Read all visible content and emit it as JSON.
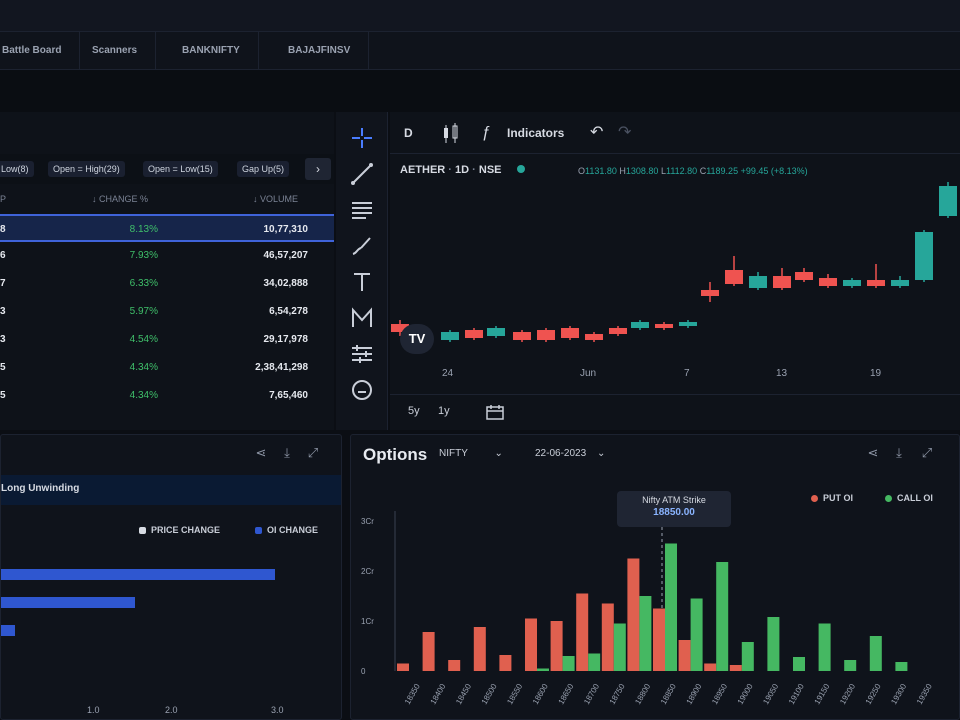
{
  "nav": {
    "tabs": [
      "Battle Board",
      "Scanners",
      "BANKNIFTY",
      "BAJAJFINSV"
    ]
  },
  "screener": {
    "filters": [
      "Low(8)",
      "Open = High(29)",
      "Open = Low(15)",
      "Gap Up(5)"
    ],
    "next_symbol": "›",
    "columns": [
      "P",
      "↓ CHANGE %",
      "↓ VOLUME"
    ],
    "rows": [
      {
        "sym": "8",
        "change": "8.13%",
        "volume": "10,77,310"
      },
      {
        "sym": "6",
        "change": "7.93%",
        "volume": "46,57,207"
      },
      {
        "sym": "7",
        "change": "6.33%",
        "volume": "34,02,888"
      },
      {
        "sym": "3",
        "change": "5.97%",
        "volume": "6,54,278"
      },
      {
        "sym": "3",
        "change": "4.54%",
        "volume": "29,17,978"
      },
      {
        "sym": "5",
        "change": "4.34%",
        "volume": "2,38,41,298"
      },
      {
        "sym": "5",
        "change": "4.34%",
        "volume": "7,65,460"
      }
    ]
  },
  "chart": {
    "interval": "D",
    "indicators_label": "Indicators",
    "symbol": "AETHER",
    "timeframe": "1D",
    "exchange": "NSE",
    "ohlc": {
      "o": "1131.80",
      "h": "1308.80",
      "l": "1112.80",
      "c": "1189.25",
      "change": "+99.45 (+8.13%)"
    },
    "x_ticks": [
      "24",
      "Jun",
      "7",
      "13",
      "19"
    ],
    "ranges": [
      "5y",
      "1y"
    ],
    "logo": "TV",
    "colors": {
      "up": "#26a69a",
      "down": "#ef5350"
    }
  },
  "oi_panel": {
    "tab_label": "Long Unwinding",
    "legend": [
      "PRICE CHANGE",
      "OI CHANGE"
    ],
    "x_ticks": [
      "1.0",
      "2.0",
      "3.0"
    ]
  },
  "options": {
    "title": "Options",
    "symbol": "NIFTY",
    "expiry": "22-06-2023",
    "legend": [
      "PUT OI",
      "CALL OI"
    ],
    "tooltip_title": "Nifty ATM Strike",
    "tooltip_value": "18850.00",
    "colors": {
      "put": "#e0604f",
      "call": "#45b862"
    }
  },
  "chart_data": {
    "type": "bar",
    "title": "",
    "y_ticks": [
      "3Cr",
      "2Cr",
      "1Cr",
      "0"
    ],
    "ylim": [
      0,
      3.2
    ],
    "categories": [
      "18350",
      "18400",
      "18450",
      "18500",
      "18550",
      "18600",
      "18650",
      "18700",
      "18750",
      "18800",
      "18850",
      "18900",
      "18950",
      "19000",
      "19050",
      "19100",
      "19150",
      "19200",
      "19250",
      "19300",
      "19350"
    ],
    "series": [
      {
        "name": "PUT OI",
        "values": [
          0.15,
          0.78,
          0.22,
          0.88,
          0.32,
          1.05,
          1.0,
          1.55,
          1.35,
          2.25,
          1.25,
          0.62,
          0.15,
          0.12,
          0,
          0,
          0,
          0,
          0,
          0,
          0
        ]
      },
      {
        "name": "CALL OI",
        "values": [
          0,
          0,
          0,
          0,
          0,
          0.05,
          0.3,
          0.35,
          0.95,
          1.5,
          2.55,
          1.45,
          2.18,
          0.58,
          1.08,
          0.28,
          0.95,
          0.22,
          0.7,
          0.18,
          0
        ]
      }
    ]
  }
}
